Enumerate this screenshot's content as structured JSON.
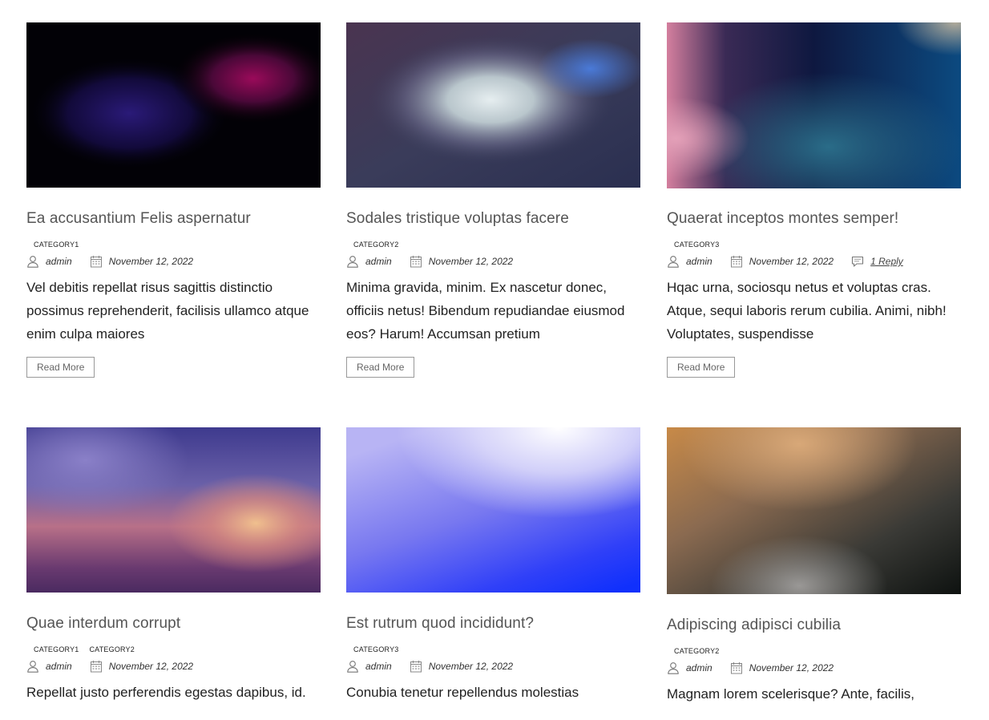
{
  "posts": [
    {
      "title": "Ea accusantium Felis aspernatur",
      "categories": [
        "CATEGORY1"
      ],
      "author": "admin",
      "date": "November 12, 2022",
      "excerpt": "Vel debitis repellat risus sagittis distinctio possimus reprehenderit, facilisis ullamco atque enim culpa maiores",
      "read_more": "Read More"
    },
    {
      "title": "Sodales tristique voluptas facere",
      "categories": [
        "CATEGORY2"
      ],
      "author": "admin",
      "date": "November 12, 2022",
      "excerpt": "Minima gravida, minim. Ex nascetur donec, officiis netus! Bibendum repudiandae eiusmod eos? Harum! Accumsan pretium",
      "read_more": "Read More"
    },
    {
      "title": "Quaerat inceptos montes semper!",
      "categories": [
        "CATEGORY3"
      ],
      "author": "admin",
      "date": "November 12, 2022",
      "comments": "1 Reply",
      "excerpt": "Hqac urna, sociosqu netus et voluptas cras. Atque, sequi laboris rerum cubilia. Animi, nibh! Voluptates, suspendisse",
      "read_more": "Read More"
    },
    {
      "title": "Quae interdum corrupt",
      "categories": [
        "CATEGORY1",
        "CATEGORY2"
      ],
      "author": "admin",
      "date": "November 12, 2022",
      "excerpt": "Repellat justo perferendis egestas dapibus, id."
    },
    {
      "title": "Est rutrum quod incididunt?",
      "categories": [
        "CATEGORY3"
      ],
      "author": "admin",
      "date": "November 12, 2022",
      "excerpt": "Conubia tenetur repellendus molestias"
    },
    {
      "title": "Adipiscing adipisci cubilia",
      "categories": [
        "CATEGORY2"
      ],
      "author": "admin",
      "date": "November 12, 2022",
      "excerpt": "Magnam lorem scelerisque? Ante, facilis,"
    }
  ],
  "icons": {
    "author": "user-icon",
    "date": "calendar-icon",
    "comments": "comment-icon"
  },
  "colors": {
    "title": "#555555",
    "text": "#222222",
    "border": "#999999"
  }
}
